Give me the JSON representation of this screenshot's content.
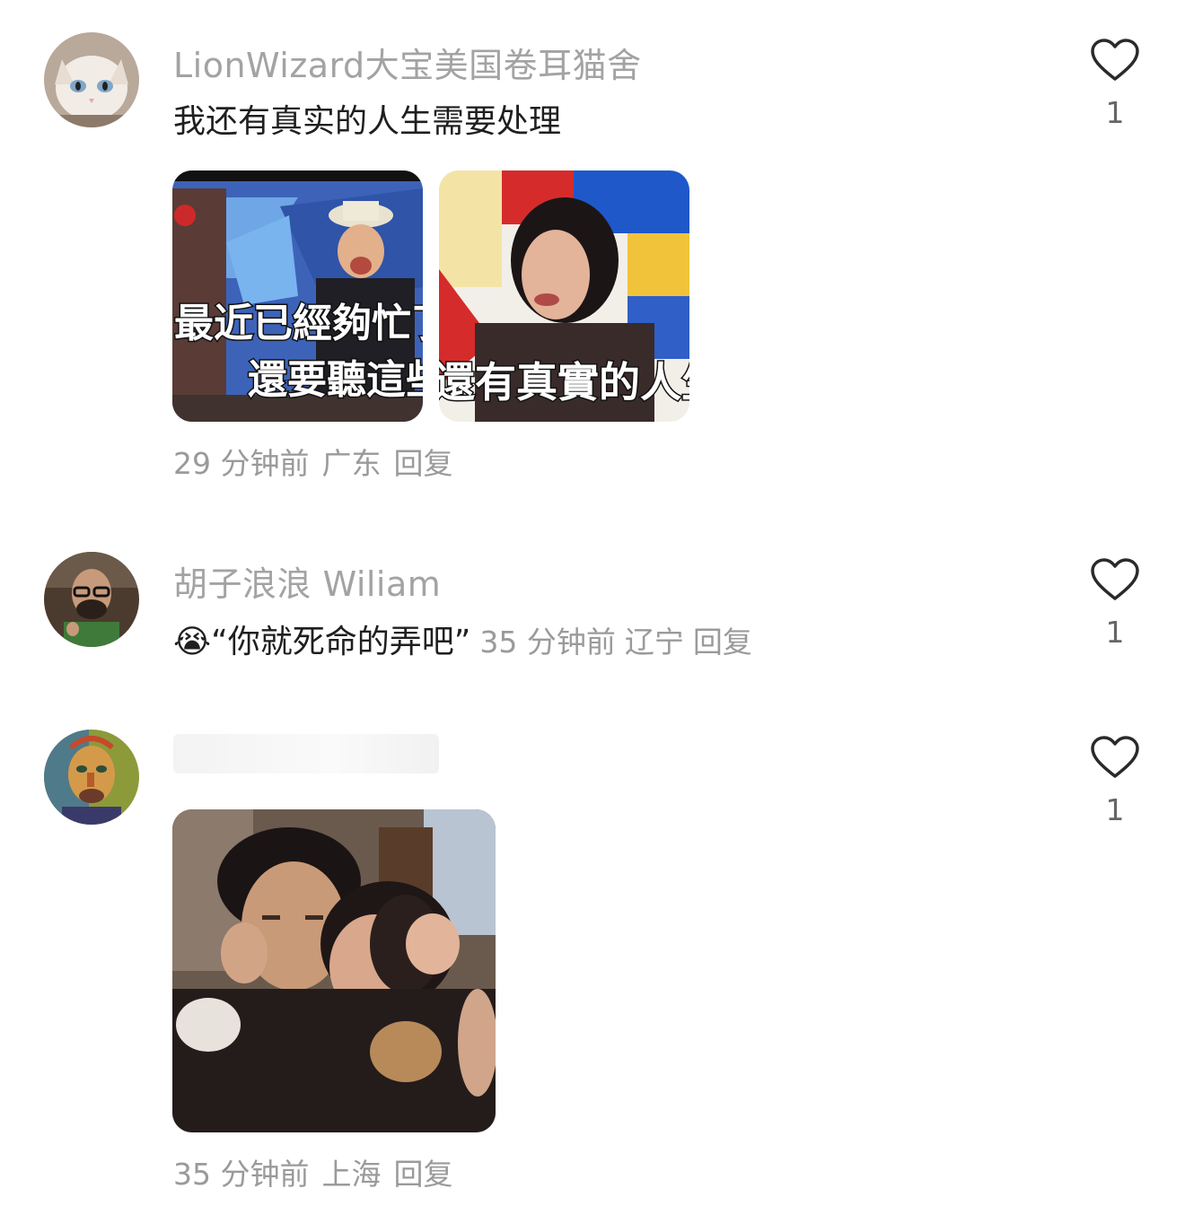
{
  "comments": [
    {
      "username": "LionWizard大宝美国卷耳猫舍",
      "text": "我还有真实的人生需要处理",
      "like_count": "1",
      "images": [
        {
          "caption_line1": "最近已經夠忙了",
          "caption_line2": "還要聽這些廢話"
        },
        {
          "caption_line1": "還有真實的人生要"
        }
      ],
      "time": "29 分钟前",
      "location": "广东",
      "reply_label": "回复"
    },
    {
      "username": "胡子浪浪 Wiliam",
      "emoji": "😭",
      "text": "“你就死命的弄吧”",
      "like_count": "1",
      "time": "35 分钟前",
      "location": "辽宁",
      "reply_label": "回复"
    },
    {
      "username": "",
      "like_count": "1",
      "time": "35 分钟前",
      "location": "上海",
      "reply_label": "回复"
    }
  ],
  "icons": {
    "like": "heart-outline-icon"
  },
  "colors": {
    "username": "#a3a3a3",
    "meta": "#9a9a9a",
    "text": "#1f1f1f"
  }
}
